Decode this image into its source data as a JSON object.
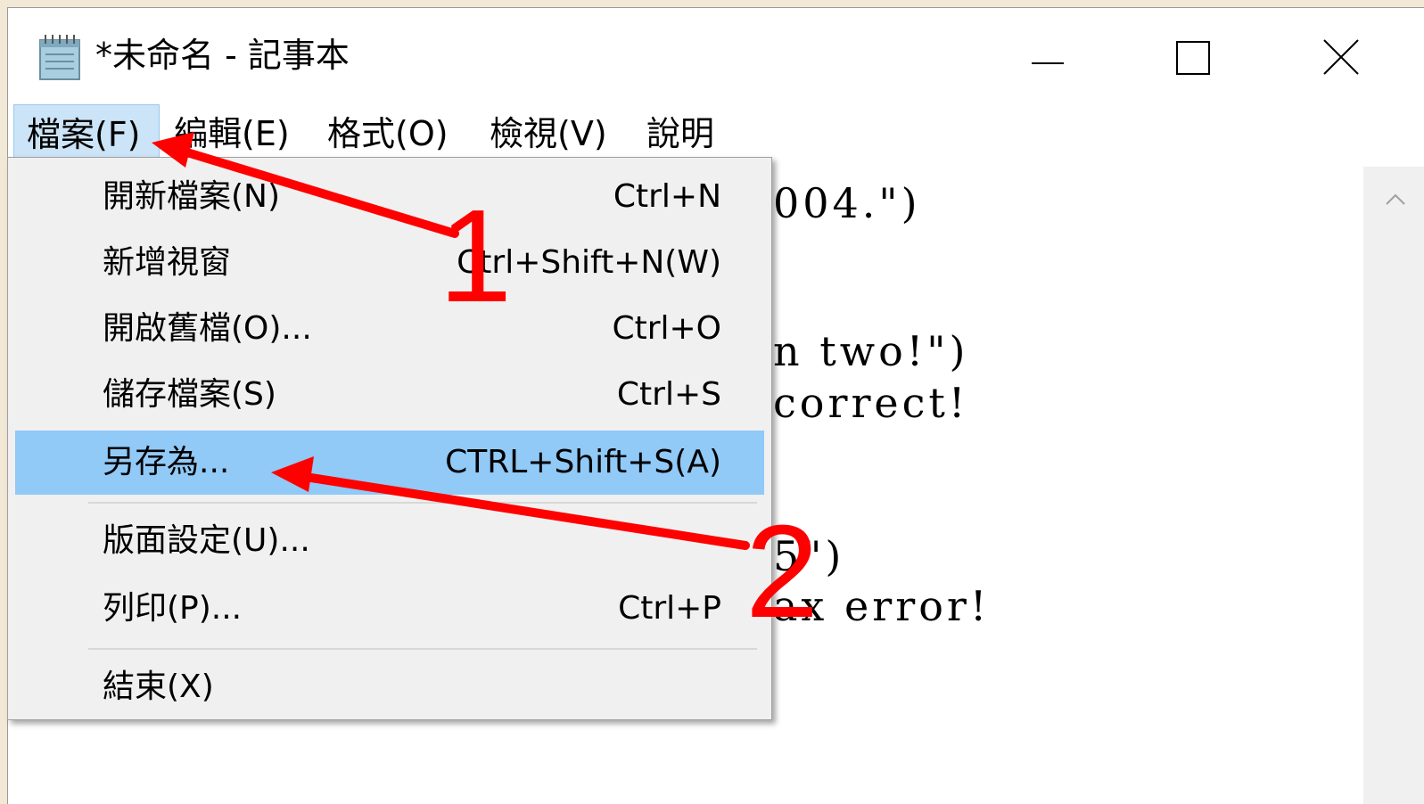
{
  "window": {
    "title": "*未命名 - 記事本"
  },
  "menubar": {
    "items": [
      {
        "label": "檔案(F)"
      },
      {
        "label": "編輯(E)"
      },
      {
        "label": "格式(O)"
      },
      {
        "label": "檢視(V)"
      },
      {
        "label": "說明"
      }
    ]
  },
  "file_menu": {
    "items": [
      {
        "label": "開新檔案(N)",
        "shortcut": "Ctrl+N"
      },
      {
        "label": "新增視窗",
        "shortcut": "Ctrl+Shift+N(W)"
      },
      {
        "label": "開啟舊檔(O)...",
        "shortcut": "Ctrl+O"
      },
      {
        "label": "儲存檔案(S)",
        "shortcut": "Ctrl+S"
      },
      {
        "label": "另存為...",
        "shortcut": "CTRL+Shift+S(A)"
      },
      {
        "label": "版面設定(U)...",
        "shortcut": ""
      },
      {
        "label": "列印(P)...",
        "shortcut": "Ctrl+P"
      },
      {
        "label": "結束(X)",
        "shortcut": ""
      }
    ],
    "highlighted_item": "另存為..."
  },
  "editor": {
    "visible_lines": [
      "004.\")",
      "n two!\")",
      "correct!",
      "5\")",
      "ax error!"
    ]
  },
  "annotations": {
    "labels": [
      "1",
      "2"
    ],
    "color": "#ff0000"
  },
  "colors": {
    "menu_active_bg": "#cce4f7",
    "dropdown_bg": "#f0f0f0",
    "dropdown_highlight": "#91c9f7",
    "page_bg": "#f2e8d6"
  }
}
